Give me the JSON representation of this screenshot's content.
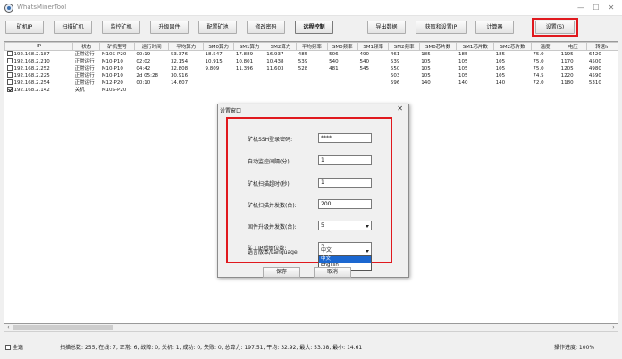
{
  "window": {
    "title": "WhatsMinerTool",
    "min": "—",
    "max": "☐",
    "close": "✕"
  },
  "toolbar": {
    "buttons": [
      {
        "label": "矿机IP",
        "active": false
      },
      {
        "label": "扫描矿机",
        "active": false
      },
      {
        "label": "监控矿机",
        "active": false
      },
      {
        "label": "升级固件",
        "active": false
      },
      {
        "label": "配置矿池",
        "active": false
      },
      {
        "label": "修改密码",
        "active": false
      },
      {
        "label": "远程控制",
        "active": true
      },
      {
        "label": "导出数据",
        "active": false
      },
      {
        "label": "获取和设置IP",
        "active": false
      },
      {
        "label": "计算器",
        "active": false
      },
      {
        "label": "设置(S)",
        "active": false
      }
    ]
  },
  "table": {
    "headers": [
      "IP",
      "状态",
      "矿机型号",
      "运行时间",
      "平均算力",
      "SM0算力",
      "SM1算力",
      "SM2算力",
      "平均频率",
      "SM0频率",
      "SM1频率",
      "SM2频率",
      "SM0芯片数",
      "SM1芯片数",
      "SM2芯片数",
      "温度",
      "电压",
      "转速In"
    ],
    "rows": [
      {
        "checked": false,
        "cells": [
          "192.168.2.187",
          "正常运行",
          "M10S-P20",
          "00:19",
          "53.376",
          "18.547",
          "17.889",
          "16.937",
          "485",
          "506",
          "490",
          "461",
          "185",
          "185",
          "185",
          "75.0",
          "1195",
          "6420"
        ]
      },
      {
        "checked": false,
        "cells": [
          "192.168.2.210",
          "正常运行",
          "M10-P10",
          "02:02",
          "32.154",
          "10.915",
          "10.801",
          "10.438",
          "539",
          "540",
          "540",
          "539",
          "105",
          "105",
          "105",
          "75.0",
          "1170",
          "4500"
        ]
      },
      {
        "checked": false,
        "cells": [
          "192.168.2.252",
          "正常运行",
          "M10-P10",
          "04:42",
          "32.808",
          "9.809",
          "11.396",
          "11.603",
          "528",
          "481",
          "545",
          "550",
          "105",
          "105",
          "105",
          "75.0",
          "1205",
          "4980"
        ]
      },
      {
        "checked": false,
        "cells": [
          "192.168.2.225",
          "正常运行",
          "M10-P10",
          "2d 05:28",
          "30.916",
          "",
          "",
          "",
          "",
          "",
          "",
          "503",
          "105",
          "105",
          "105",
          "74.5",
          "1220",
          "4590"
        ]
      },
      {
        "checked": false,
        "cells": [
          "192.168.2.254",
          "正常运行",
          "M12-P20",
          "00:10",
          "14.607",
          "",
          "",
          "",
          "",
          "",
          "",
          "596",
          "140",
          "140",
          "140",
          "72.0",
          "1180",
          "5310"
        ]
      },
      {
        "checked": true,
        "cells": [
          "192.168.2.142",
          "关机",
          "M10S-P20",
          "",
          "",
          "",
          "",
          "",
          "",
          "",
          "",
          "",
          "",
          "",
          "",
          "",
          "",
          ""
        ]
      }
    ]
  },
  "scrollbar": {
    "left": "‹",
    "right": "›"
  },
  "status": {
    "select_all": "全选",
    "summary": "扫描总数: 255, 在线: 7, 正常: 6, 故障: 0, 关机: 1, 成功: 0, 失败: 0, 总算力: 197.51, 平均: 32.92, 最大: 53.38, 最小: 14.61",
    "progress": "操作进度: 100%"
  },
  "dialog": {
    "title": "设置窗口",
    "close": "✕",
    "fields": {
      "ssh_password_label": "矿机SSH登录密码:",
      "ssh_password_value": "****",
      "monitor_interval_label": "自动监控间隔(分):",
      "monitor_interval_value": "1",
      "scan_timeout_label": "矿机扫描超时(秒):",
      "scan_timeout_value": "1",
      "scan_concurrency_label": "矿机扫描并发数(台):",
      "scan_concurrency_value": "200",
      "upgrade_concurrency_label": "固件升级并发数(台):",
      "upgrade_concurrency_value": "5",
      "ip_suffix_label": "矿工IP后缀位数:",
      "ip_suffix_value": "3",
      "language_label": "语言版本/Language:",
      "language_value": "中文"
    },
    "language_options": [
      "中文",
      "English"
    ],
    "save": "保存",
    "cancel": "取消"
  },
  "colors": {
    "highlight": "#e0191e",
    "selection": "#1b67d0"
  }
}
